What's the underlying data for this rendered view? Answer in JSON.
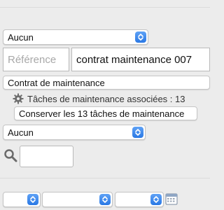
{
  "top_select": {
    "value": "Aucun"
  },
  "reference": {
    "label": "Référence",
    "value": "contrat maintenance 007"
  },
  "contract_type": {
    "label": "Contrat de maintenance"
  },
  "tasks": {
    "label": "Tâches de maintenance associées : 13"
  },
  "keep_button": {
    "label": "Conserver les 13 tâches de maintenance"
  },
  "second_select": {
    "value": "Aucun"
  },
  "search": {
    "value": ""
  },
  "bottom_selects": [
    {
      "value": ""
    },
    {
      "value": ""
    },
    {
      "value": ""
    }
  ],
  "colors": {
    "accent": "#2a78e4",
    "background": "#ececec"
  }
}
